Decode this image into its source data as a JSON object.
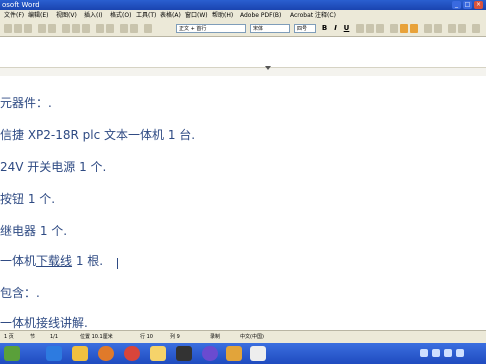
{
  "window": {
    "title": "osoft Word"
  },
  "menu": {
    "items": [
      "文件(F)",
      "编辑(E)",
      "视图(V)",
      "插入(I)",
      "格式(O)",
      "工具(T)",
      "表格(A)",
      "窗口(W)",
      "帮助(H)",
      "Adobe PDF(B)",
      "Acrobat 注释(C)"
    ]
  },
  "toolbar": {
    "style_value": "正文 + 首行",
    "font_value": "宋体",
    "size_value": "四号",
    "bold": "B",
    "italic": "I",
    "underline": "U"
  },
  "document": {
    "lines": [
      "元器件：.",
      "信捷 XP2-18R plc 文本一体机 1 台.",
      "24V 开关电源 1 个.",
      "按钮 1 个.",
      "继电器 1 个.",
      "一体机下载线 1 根.",
      "包含：.",
      "一体机接线讲解."
    ],
    "underline_word": "下载线"
  },
  "statusbar": {
    "page": "1 页",
    "section": "节",
    "position": "1/1",
    "at": "位置 10.1厘米",
    "row": "行 10",
    "col": "列 9",
    "rec": "录制",
    "lang": "中文(中国)"
  },
  "taskbar": {
    "apps": [
      "ie-icon",
      "folder-icon",
      "media-icon",
      "chrome-icon",
      "explorer-icon",
      "terminal-icon",
      "app-icon",
      "plc-icon",
      "word-icon"
    ]
  }
}
